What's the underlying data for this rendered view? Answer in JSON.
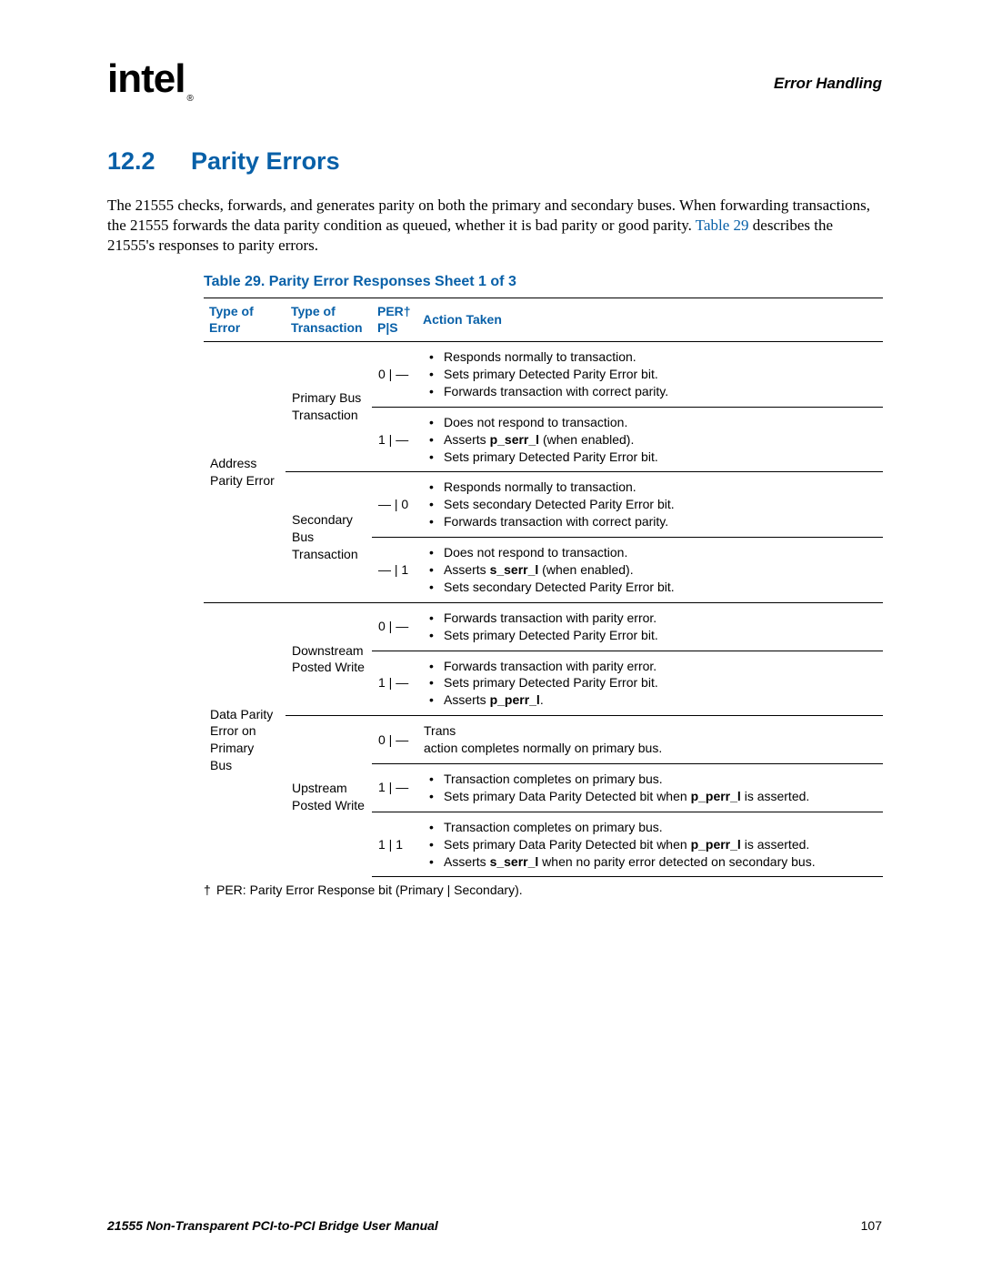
{
  "header": {
    "logo_text": "intel",
    "logo_reg": "®",
    "page_label": "Error Handling"
  },
  "section": {
    "number": "12.2",
    "title": "Parity Errors"
  },
  "paragraph": {
    "text_part1": "The 21555 checks, forwards, and generates parity on both the primary and secondary buses. When forwarding transactions, the 21555 forwards the data parity condition as queued, whether it is bad parity or good parity. ",
    "link": "Table 29",
    "text_part2": " describes the 21555's responses to parity errors."
  },
  "table": {
    "caption": "Table 29.  Parity Error Responses  Sheet 1 of 3",
    "headers": {
      "col1": "Type of Error",
      "col2": "Type of Transaction",
      "col3_top": "PER†",
      "col3_bot": "P|S",
      "col4": "Action Taken"
    },
    "rows": [
      {
        "error": "Address Parity Error",
        "transaction": "Primary Bus Transaction",
        "per": "0 | —",
        "actions": [
          "Responds normally to transaction.",
          "Sets primary Detected Parity Error bit.",
          "Forwards transaction with correct parity."
        ]
      },
      {
        "per": "1 | —",
        "actions": [
          "Does not respond to transaction.",
          {
            "pre": "Asserts ",
            "bold": "p_serr_l",
            "post": " (when enabled)."
          },
          "Sets primary Detected Parity Error bit."
        ]
      },
      {
        "transaction": "Secondary Bus Transaction",
        "per": "— | 0",
        "actions": [
          "Responds normally to transaction.",
          "Sets secondary Detected Parity Error bit.",
          "Forwards transaction with correct parity."
        ]
      },
      {
        "per": "— | 1",
        "actions": [
          "Does not respond to transaction.",
          {
            "pre": "Asserts ",
            "bold": "s_serr_l",
            "post": " (when enabled)."
          },
          "Sets secondary Detected Parity Error bit."
        ]
      },
      {
        "error": "Data Parity Error on Primary Bus",
        "transaction": "Downstream Posted Write",
        "per": "0 | —",
        "actions": [
          "Forwards transaction with parity error.",
          "Sets primary Detected Parity Error bit."
        ]
      },
      {
        "per": "1 | —",
        "actions": [
          "Forwards transaction with parity error.",
          "Sets primary Detected Parity Error bit.",
          {
            "pre": "Asserts ",
            "bold": "p_perr_l",
            "post": "."
          }
        ]
      },
      {
        "transaction": "Upstream Posted Write",
        "per": "0 | —",
        "plain": "Trans\naction completes normally on primary bus."
      },
      {
        "per": "1 | —",
        "actions": [
          "Transaction completes on primary bus.",
          {
            "pre": "Sets primary Data Parity Detected bit when ",
            "bold": "p_perr_l",
            "post": " is asserted."
          }
        ]
      },
      {
        "per": "1 | 1",
        "actions": [
          "Transaction completes on primary bus.",
          {
            "pre": "Sets primary Data Parity Detected bit when ",
            "bold": "p_perr_l",
            "post": " is asserted."
          },
          {
            "pre": "Asserts ",
            "bold": "s_serr_l",
            "post": " when no parity error detected on secondary bus."
          }
        ]
      }
    ]
  },
  "footnote": {
    "dagger": "†",
    "text": "PER: Parity Error Response bit (Primary | Secondary)."
  },
  "footer": {
    "title": "21555 Non-Transparent PCI-to-PCI Bridge User Manual",
    "page": "107"
  }
}
